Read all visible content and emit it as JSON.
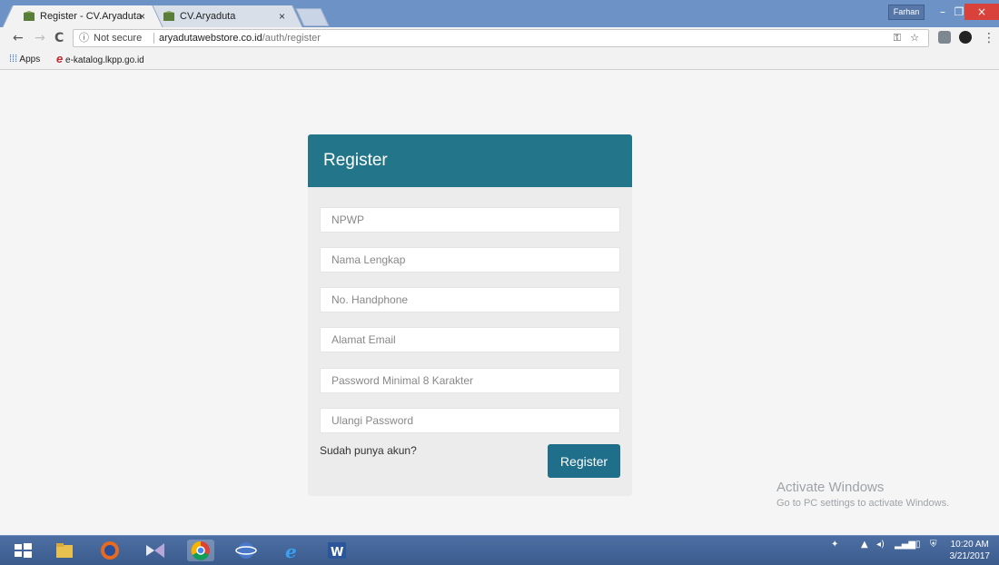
{
  "browser": {
    "tabs": [
      {
        "title": "Register - CV.Aryaduta",
        "close": "×"
      },
      {
        "title": "CV.Aryaduta",
        "close": "×"
      }
    ],
    "profile": "Farhan",
    "window_controls": {
      "minimize": "–",
      "restore": "❐",
      "close": "×"
    },
    "nav": {
      "back": "←",
      "forward": "→",
      "reload": "C"
    },
    "address": {
      "security_label": "Not secure",
      "host": "aryadutawebstore.co.id",
      "path": "/auth/register"
    },
    "bookmarks": {
      "apps_label": "Apps",
      "items": [
        "e-katalog.lkpp.go.id"
      ]
    }
  },
  "register": {
    "title": "Register",
    "fields": {
      "npwp": "NPWP",
      "full_name": "Nama Lengkap",
      "phone": "No. Handphone",
      "email": "Alamat Email",
      "password": "Password Minimal 8 Karakter",
      "password_repeat": "Ulangi Password"
    },
    "login_link": "Sudah punya akun?",
    "submit_label": "Register"
  },
  "watermark": {
    "line1": "Activate Windows",
    "line2": "Go to PC settings to activate Windows."
  },
  "taskbar": {
    "time": "10:20 AM",
    "date": "3/21/2017"
  },
  "colors": {
    "header": "#23768a",
    "button": "#1f6f8b",
    "card": "#ececec"
  }
}
